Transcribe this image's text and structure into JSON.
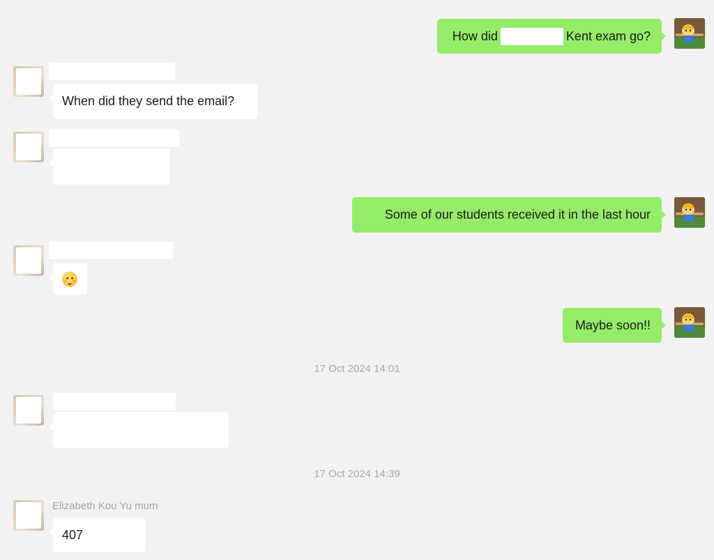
{
  "colors": {
    "background": "#f2f2f2",
    "my_bubble": "#95ec69",
    "their_bubble": "#ffffff",
    "meta_text": "#a8a8a8"
  },
  "messages": [
    {
      "from": "me",
      "text_before": "How did",
      "text_after": "Kent exam go?"
    },
    {
      "from": "them",
      "text": "When did they send the email?"
    },
    {
      "from": "them",
      "text": ""
    },
    {
      "from": "me",
      "text": "Some of our students received it in the last hour"
    },
    {
      "from": "them",
      "emoji": "smiling-face-with-blush-icon"
    },
    {
      "from": "me",
      "text": "Maybe soon!!"
    },
    {
      "timestamp": "17 Oct 2024 14:01"
    },
    {
      "from": "them",
      "text": ""
    },
    {
      "timestamp": "17 Oct 2024 14:39"
    },
    {
      "from": "them",
      "sender_name": "Elizabeth Kou Yu mum",
      "text": "407"
    }
  ]
}
